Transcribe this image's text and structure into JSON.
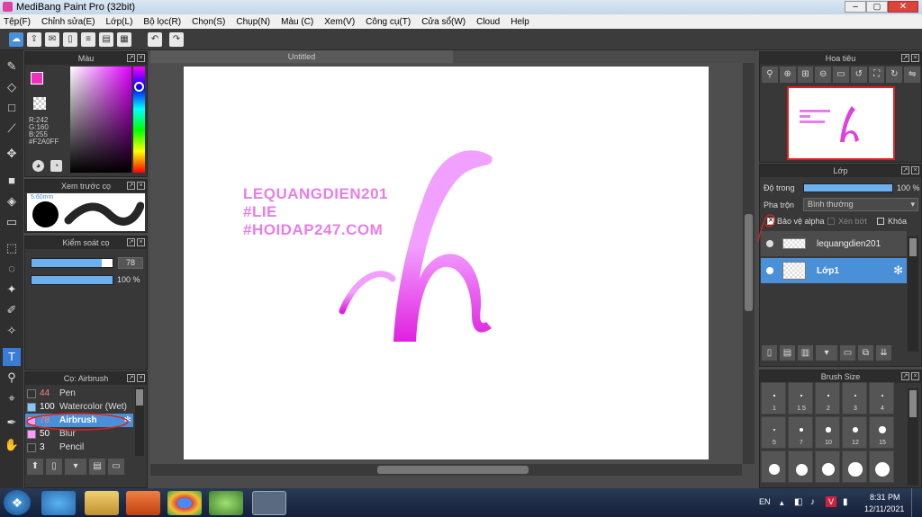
{
  "window": {
    "title": "MediBang Paint Pro (32bit)"
  },
  "menu": [
    "Tệp(F)",
    "Chỉnh sửa(E)",
    "Lớp(L)",
    "Bộ lọc(R)",
    "Chọn(S)",
    "Chụp(N)",
    "Màu (C)",
    "Xem(V)",
    "Công cụ(T)",
    "Cửa sổ(W)",
    "Cloud",
    "Help"
  ],
  "color_panel": {
    "title": "Màu",
    "r": "R:242",
    "g": "G:160",
    "b": "B:255",
    "hex": "#F2A0FF",
    "primary_color": "#f030c0",
    "hue_indicator_color": "#ff00ff"
  },
  "brush_preview": {
    "title": "Xem trước cọ",
    "size": "5.60mm"
  },
  "brush_control": {
    "title": "Kiểm soát cọ",
    "size_value": "78",
    "opacity_value": "100 %"
  },
  "brush_list": {
    "title": "Cọ: Airbrush",
    "items": [
      {
        "size": "44",
        "name": "Pen",
        "color": "#333333",
        "selected": false,
        "size_color": "#ff8080"
      },
      {
        "size": "100",
        "name": "Watercolor (Wet)",
        "color": "#7ec8ff",
        "selected": false,
        "size_color": "#ffffff"
      },
      {
        "size": "78",
        "name": "Airbrush",
        "color": "#ff99ff",
        "selected": true,
        "size_color": "#ff8080"
      },
      {
        "size": "50",
        "name": "Blur",
        "color": "#ff99ff",
        "selected": false,
        "size_color": "#ffffff"
      },
      {
        "size": "3",
        "name": "Pencil",
        "color": "#333333",
        "selected": false,
        "size_color": "#ffffff"
      }
    ]
  },
  "document": {
    "title": "Untitled"
  },
  "artwork": {
    "lines": [
      "LEQUANGDIEN201",
      "#LIE",
      "#HOIDAP247.COM"
    ],
    "text_color": "#e97de8",
    "letter_top": "#f2a0ff",
    "letter_bottom": "#e020e0"
  },
  "navigator": {
    "title": "Hoa tiêu"
  },
  "layer_panel": {
    "title": "Lớp",
    "opacity_label": "Độ trong",
    "opacity_value": "100 %",
    "blend_label": "Pha trộn",
    "blend_value": "Bình thường",
    "protect_alpha": "Bảo vệ alpha",
    "clipping": "Xén bớt",
    "lock": "Khóa",
    "layers": [
      {
        "name": "lequangdien201",
        "selected": false
      },
      {
        "name": "Lớp1",
        "selected": true
      }
    ]
  },
  "brush_size": {
    "title": "Brush Size",
    "labels": [
      "1",
      "1.5",
      "2",
      "3",
      "4",
      "5",
      "7",
      "10",
      "12",
      "15"
    ]
  },
  "taskbar": {
    "lang": "EN",
    "time": "8:31 PM",
    "date": "12/11/2021"
  }
}
